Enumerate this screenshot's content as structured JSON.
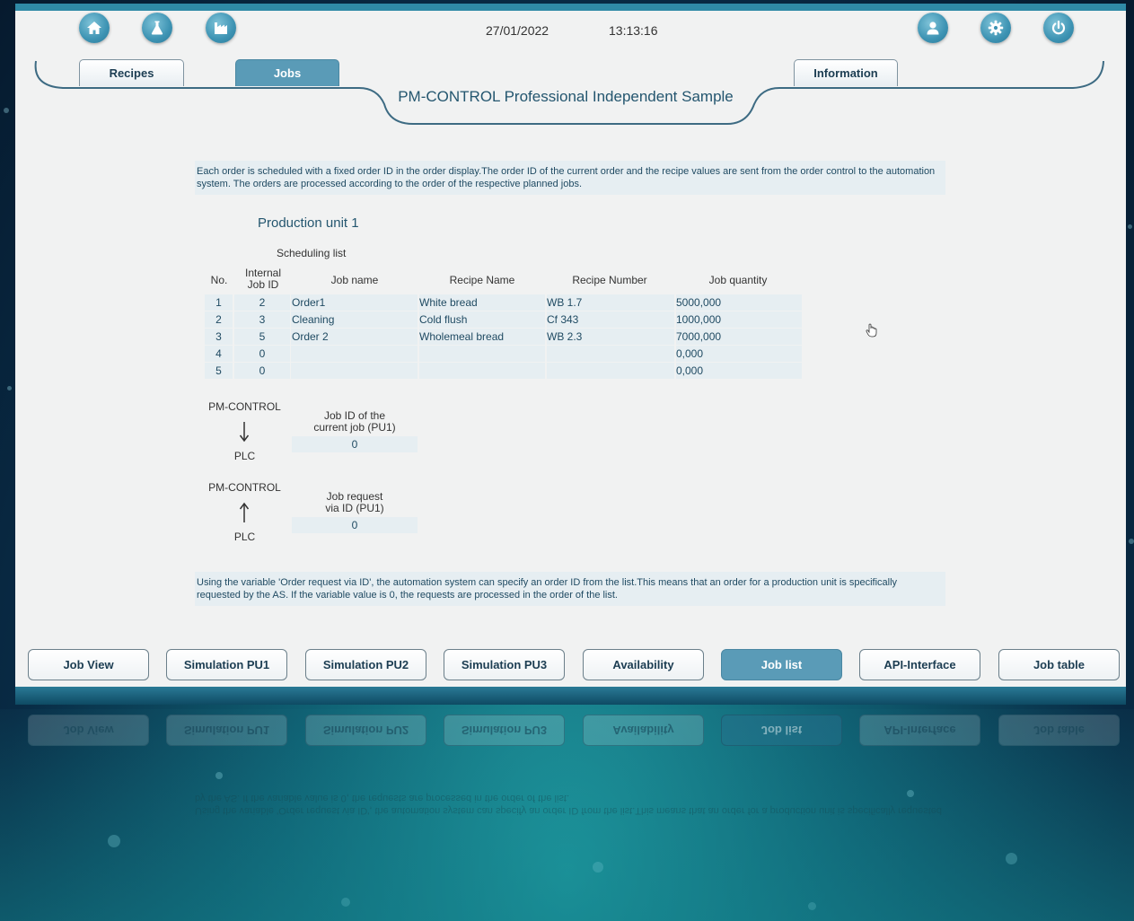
{
  "header": {
    "date": "27/01/2022",
    "time": "13:13:16",
    "left_icons": [
      "home-icon",
      "flask-icon",
      "factory-icon"
    ],
    "right_icons": [
      "user-icon",
      "gear-icon",
      "power-icon"
    ]
  },
  "tabs": {
    "recipes": "Recipes",
    "jobs": "Jobs",
    "information": "Information"
  },
  "app_title": "PM-CONTROL Professional Independent Sample",
  "intro_text": "Each order is scheduled with a fixed order ID in the order display.The order ID of the current order and the recipe values are sent from the order control to the automation system. The orders are processed according to the order of the respective planned jobs.",
  "production_unit": "Production unit 1",
  "scheduling_list": {
    "title": "Scheduling list",
    "columns": {
      "no": "No.",
      "internal_id": "Internal Job ID",
      "job_name": "Job name",
      "recipe_name": "Recipe Name",
      "recipe_number": "Recipe Number",
      "job_quantity": "Job quantity"
    },
    "rows": [
      {
        "no": "1",
        "id": "2",
        "job": "Order1",
        "recipe": "White bread",
        "number": "WB 1.7",
        "qty": "5000,000"
      },
      {
        "no": "2",
        "id": "3",
        "job": "Cleaning",
        "recipe": "Cold flush",
        "number": "Cf 343",
        "qty": "1000,000"
      },
      {
        "no": "3",
        "id": "5",
        "job": "Order 2",
        "recipe": "Wholemeal bread",
        "number": "WB 2.3",
        "qty": "7000,000"
      },
      {
        "no": "4",
        "id": "0",
        "job": "",
        "recipe": "",
        "number": "",
        "qty": "0,000"
      },
      {
        "no": "5",
        "id": "0",
        "job": "",
        "recipe": "",
        "number": "",
        "qty": "0,000"
      }
    ]
  },
  "current_job": {
    "source": "PM-CONTROL",
    "target": "PLC",
    "label_line1": "Job ID of the",
    "label_line2": "current job (PU1)",
    "value": "0"
  },
  "job_request": {
    "source": "PM-CONTROL",
    "target": "PLC",
    "label_line1": "Job request",
    "label_line2": "via ID (PU1)",
    "value": "0"
  },
  "footer_text": "Using the variable 'Order request via ID', the automation system can specify an order ID from the list.This means that an order for a production unit is specifically requested by the AS.  If the variable value is 0, the requests are processed in the order of the list.",
  "nav_buttons": [
    "Job View",
    "Simulation PU1",
    "Simulation PU2",
    "Simulation PU3",
    "Availability",
    "Job list",
    "API-Interface",
    "Job table"
  ],
  "nav_active": "Job list",
  "colors": {
    "accent": "#5a9bb7",
    "text_dark": "#1f4a62",
    "panel_bg": "#f1f2f2",
    "cell_bg": "#e6eef2"
  }
}
